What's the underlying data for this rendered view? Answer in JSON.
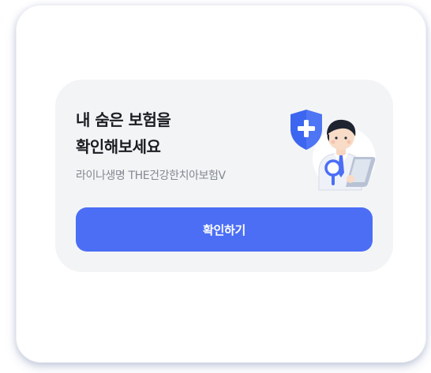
{
  "card": {
    "headline_line1": "내 숨은 보험을",
    "headline_line2": "확인해보세요",
    "subtitle": "라이나생명 THE건강한치아보험V",
    "confirm_button_label": "확인하기",
    "illustration": {
      "shield_icon": "shield-plus-icon",
      "person": "doctor-with-tablet"
    }
  },
  "colors": {
    "accent": "#4b6ef5",
    "card_background": "#f3f4f6",
    "headline_text": "#1b1d22",
    "subtitle_text": "#838891"
  }
}
